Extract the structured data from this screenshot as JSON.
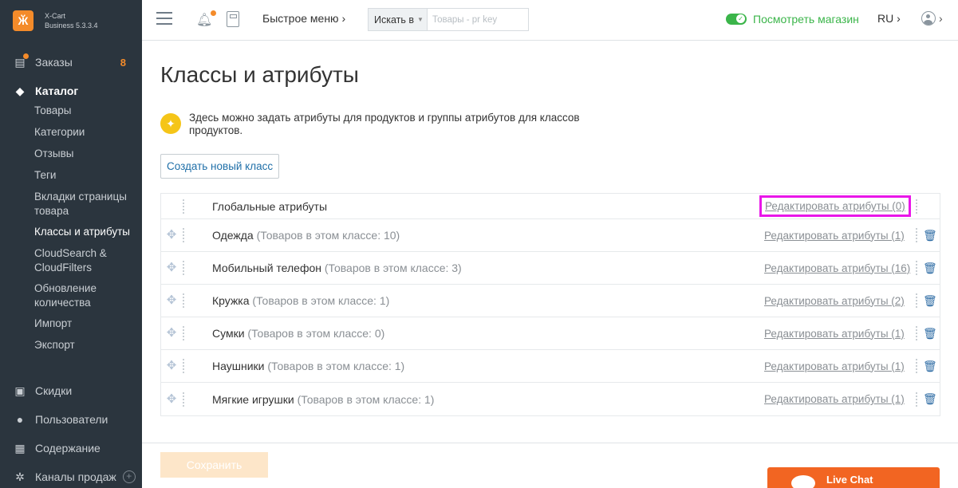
{
  "brand": {
    "logo": "Ӂ",
    "name_line1": "X-Cart",
    "name_line2": "Business 5.3.3.4"
  },
  "sidebar": {
    "orders": {
      "label": "Заказы",
      "badge": "8"
    },
    "catalog": {
      "label": "Каталог"
    },
    "catalog_items": [
      {
        "label": "Товары"
      },
      {
        "label": "Категории"
      },
      {
        "label": "Отзывы"
      },
      {
        "label": "Теги"
      },
      {
        "label": "Вкладки страницы товара"
      },
      {
        "label": "Классы и атрибуты"
      },
      {
        "label": "CloudSearch & CloudFilters"
      },
      {
        "label": "Обновление количества"
      },
      {
        "label": "Импорт"
      },
      {
        "label": "Экспорт"
      }
    ],
    "bottom": [
      {
        "label": "Скидки"
      },
      {
        "label": "Пользователи"
      },
      {
        "label": "Содержание"
      },
      {
        "label": "Каналы продаж",
        "extra": "+"
      }
    ]
  },
  "header": {
    "quick_menu": "Быстрое меню ›",
    "search_select": "Искать в",
    "search_placeholder": "Товары - pr key",
    "view_store": "Посмотреть магазин",
    "lang": "RU ›",
    "user_chevron": "›"
  },
  "main": {
    "title": "Классы и атрибуты",
    "help_text": "Здесь можно задать атрибуты для продуктов и группы атрибутов для классов продуктов.",
    "create_button": "Создать новый класс",
    "classes": [
      {
        "name": "Глобальные атрибуты",
        "count": "",
        "edit": "Редактировать атрибуты (0)"
      },
      {
        "name": "Одежда",
        "count": "(Товаров в этом классе: 10)",
        "edit": "Редактировать атрибуты (1)"
      },
      {
        "name": "Мобильный телефон",
        "count": "(Товаров в этом классе: 3)",
        "edit": "Редактировать атрибуты (16)"
      },
      {
        "name": "Кружка",
        "count": "(Товаров в этом классе: 1)",
        "edit": "Редактировать атрибуты (2)"
      },
      {
        "name": "Сумки",
        "count": "(Товаров в этом классе: 0)",
        "edit": "Редактировать атрибуты (1)"
      },
      {
        "name": "Наушники",
        "count": "(Товаров в этом классе: 1)",
        "edit": "Редактировать атрибуты (1)"
      },
      {
        "name": "Мягкие игрушки",
        "count": "(Товаров в этом классе: 1)",
        "edit": "Редактировать атрибуты (1)"
      }
    ],
    "save_button": "Сохранить",
    "live_chat": "Live Chat"
  },
  "colors": {
    "accent": "#f48b2a",
    "sidebar_bg": "#2b353e",
    "link": "#1f6fa8",
    "highlight": "#e916e9",
    "store_green": "#3bb54a"
  }
}
